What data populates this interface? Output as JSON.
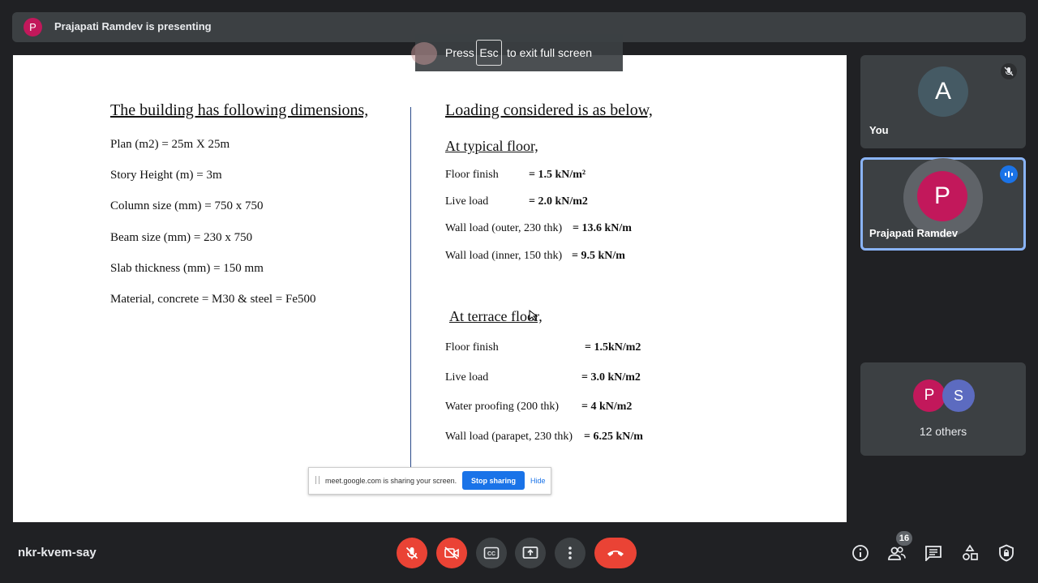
{
  "banner": {
    "avatar_letter": "P",
    "text": "Prajapati Ramdev is presenting"
  },
  "esc_hint": {
    "press": "Press",
    "key": "Esc",
    "rest": "to exit full screen"
  },
  "slide": {
    "left": {
      "heading": "The building has following dimensions,",
      "lines": [
        "Plan (m2) =  25m X 25m",
        "Story Height (m) = 3m",
        "Column size (mm) = 750 x 750",
        "Beam size (mm) = 230 x 750",
        "Slab thickness (mm) = 150 mm",
        "Material, concrete = M30 & steel = Fe500"
      ]
    },
    "right": {
      "heading": "Loading considered is as below,",
      "typical": {
        "heading": "At typical floor,",
        "rows": [
          {
            "label": "Floor finish",
            "value": "= 1.5 kN/m²"
          },
          {
            "label": "Live load",
            "value": "= 2.0 kN/m2"
          },
          {
            "label": "Wall load (outer, 230 thk)",
            "value": "= 13.6 kN/m"
          },
          {
            "label": "Wall load (inner, 150 thk)",
            "value": "= 9.5 kN/m"
          }
        ]
      },
      "terrace": {
        "heading": "At terrace floor,",
        "rows": [
          {
            "label": "Floor finish",
            "value": "= 1.5kN/m2"
          },
          {
            "label": "Live load",
            "value": "= 3.0 kN/m2"
          },
          {
            "label": "Water proofing (200 thk)",
            "value": "= 4 kN/m2"
          },
          {
            "label": "Wall load (parapet, 230 thk)",
            "value": "= 6.25 kN/m"
          }
        ]
      }
    }
  },
  "share_bar": {
    "message": "meet.google.com is sharing your screen.",
    "stop": "Stop sharing",
    "hide": "Hide"
  },
  "participants": {
    "you": {
      "letter": "A",
      "name": "You",
      "muted_icon": "mic-off-icon"
    },
    "presenter": {
      "letter": "P",
      "name": "Prajapati Ramdev",
      "speaking_icon": "audio-level-icon"
    },
    "others": {
      "letters": [
        "P",
        "S"
      ],
      "label": "12 others"
    }
  },
  "bottom": {
    "meeting_code": "nkr-kvem-say",
    "people_count": "16",
    "controls": [
      "mic-off-icon",
      "camera-off-icon",
      "captions-icon",
      "present-icon",
      "more-vert-icon",
      "end-call-icon"
    ],
    "right_icons": [
      "info-icon",
      "people-icon",
      "chat-icon",
      "activities-icon",
      "host-controls-icon"
    ]
  },
  "colors": {
    "background": "#202124",
    "tile": "#3c4043",
    "danger": "#ea4335",
    "accent": "#8ab4f8",
    "presenter_avatar": "#c2185b",
    "you_avatar": "#455a64",
    "s_avatar": "#5c6bc0"
  }
}
